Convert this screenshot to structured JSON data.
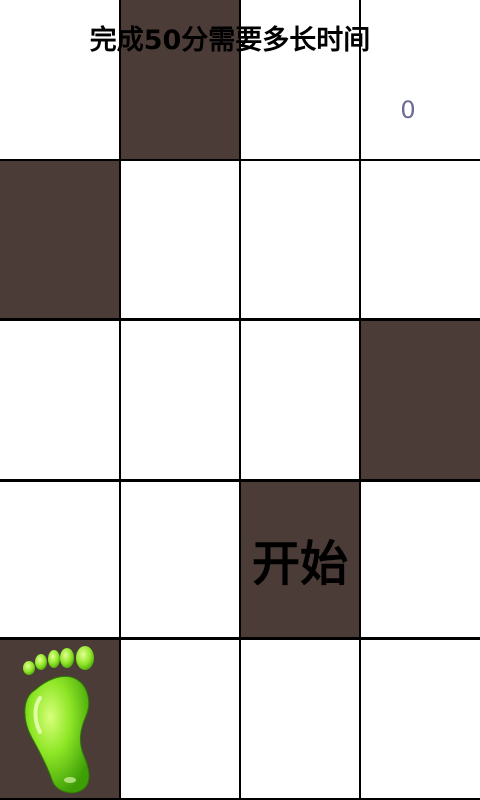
{
  "header": {
    "title": "完成50分需要多长时间",
    "score": "0"
  },
  "board": {
    "rows": [
      [
        "white",
        "dark",
        "white",
        "white"
      ],
      [
        "dark",
        "white",
        "white",
        "white"
      ],
      [
        "white",
        "white",
        "white",
        "dark"
      ],
      [
        "white",
        "white",
        "dark",
        "white"
      ],
      [
        "dark",
        "white",
        "white",
        "white"
      ]
    ]
  },
  "start_tile": {
    "label": "开始"
  },
  "footprint": {
    "icon": "green-footprint-icon"
  },
  "colors": {
    "tile_white": "#ffffff",
    "tile_dark": "#4b3c38",
    "grid_lines": "#000000",
    "score_text": "#6b6a95",
    "foot_green": "#7ee21a"
  }
}
